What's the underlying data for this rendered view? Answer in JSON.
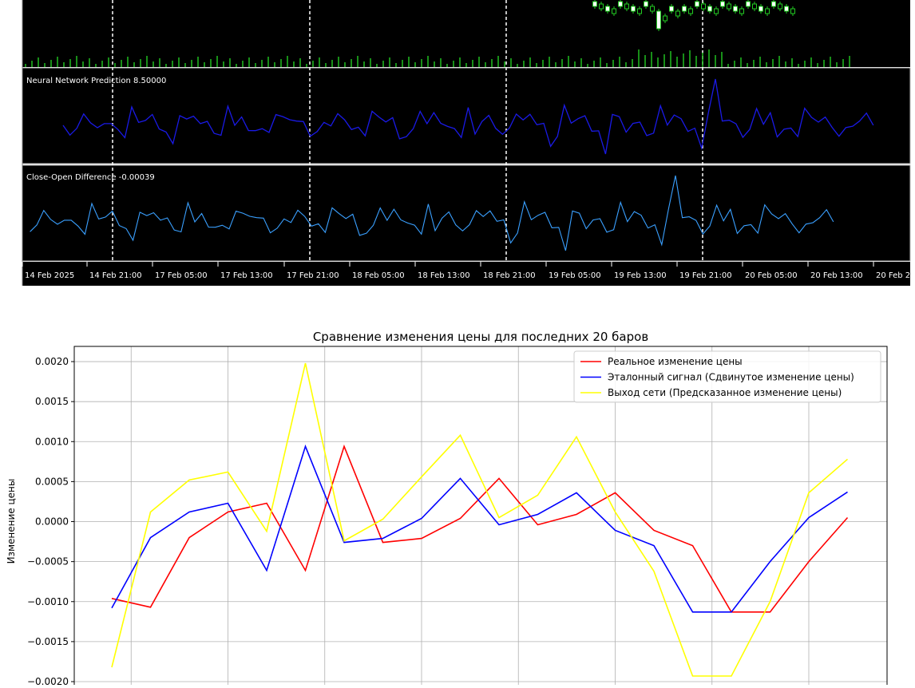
{
  "terminal": {
    "prediction_label": "Neural Network Prediction 8.50000",
    "difference_label": "Close-Open Difference -0.00039",
    "time_labels": [
      "14 Feb 2025",
      "14 Feb 21:00",
      "17 Feb 05:00",
      "17 Feb 13:00",
      "17 Feb 21:00",
      "18 Feb 05:00",
      "18 Feb 13:00",
      "18 Feb 21:00",
      "19 Feb 05:00",
      "19 Feb 13:00",
      "19 Feb 21:00",
      "20 Feb 05:00",
      "20 Feb 13:00",
      "20 Feb 2"
    ],
    "colors": {
      "background": "#000000",
      "prediction": "#1a1ae6",
      "difference": "#3aa0ff",
      "volume": "#22cc22",
      "separator": "#ffffff"
    }
  },
  "chart_data": {
    "type": "line",
    "title": "Сравнение изменения цены для последних 20 баров",
    "ylabel": "Изменение цены",
    "ylim": [
      -0.002,
      0.0022
    ],
    "yticks": [
      0.002,
      0.0015,
      0.001,
      0.0005,
      0.0,
      -0.0005,
      -0.001,
      -0.0015,
      -0.002
    ],
    "ytick_labels": [
      "0.0020",
      "0.0015",
      "0.0010",
      "0.0005",
      "0.0000",
      "−0.0005",
      "−0.0010",
      "−0.0015",
      "−0.0020"
    ],
    "x": [
      0,
      1,
      2,
      3,
      4,
      5,
      6,
      7,
      8,
      9,
      10,
      11,
      12,
      13,
      14,
      15,
      16,
      17,
      18,
      19
    ],
    "grid": true,
    "legend_position": "top-right",
    "series": [
      {
        "name": "Реальное изменение цены",
        "color": "#ff0000",
        "values": [
          -0.00096,
          -0.00107,
          -0.0002,
          0.00012,
          0.00023,
          -0.00061,
          0.00094,
          -0.00026,
          -0.00021,
          4e-05,
          0.00054,
          -4e-05,
          9e-05,
          0.00036,
          -0.00011,
          -0.0003,
          -0.00113,
          -0.00113,
          -0.0005,
          5e-05
        ]
      },
      {
        "name": "Эталонный сигнал (Сдвинутое изменение цены)",
        "color": "#0000ff",
        "values": [
          -0.00108,
          -0.0002,
          0.00012,
          0.00023,
          -0.00061,
          0.00094,
          -0.00026,
          -0.00021,
          4e-05,
          0.00054,
          -4e-05,
          9e-05,
          0.00036,
          -0.00011,
          -0.0003,
          -0.00113,
          -0.00113,
          -0.0005,
          5e-05,
          0.00037
        ]
      },
      {
        "name": "Выход сети (Предсказанное изменение цены)",
        "color": "#ffff00",
        "values": [
          -0.00182,
          0.00012,
          0.00052,
          0.00062,
          -0.00012,
          0.00198,
          -0.00024,
          3e-05,
          0.00056,
          0.00108,
          5e-05,
          0.00033,
          0.00106,
          0.00012,
          -0.00062,
          -0.00193,
          -0.00193,
          -0.001,
          0.00036,
          0.00078
        ]
      }
    ]
  }
}
